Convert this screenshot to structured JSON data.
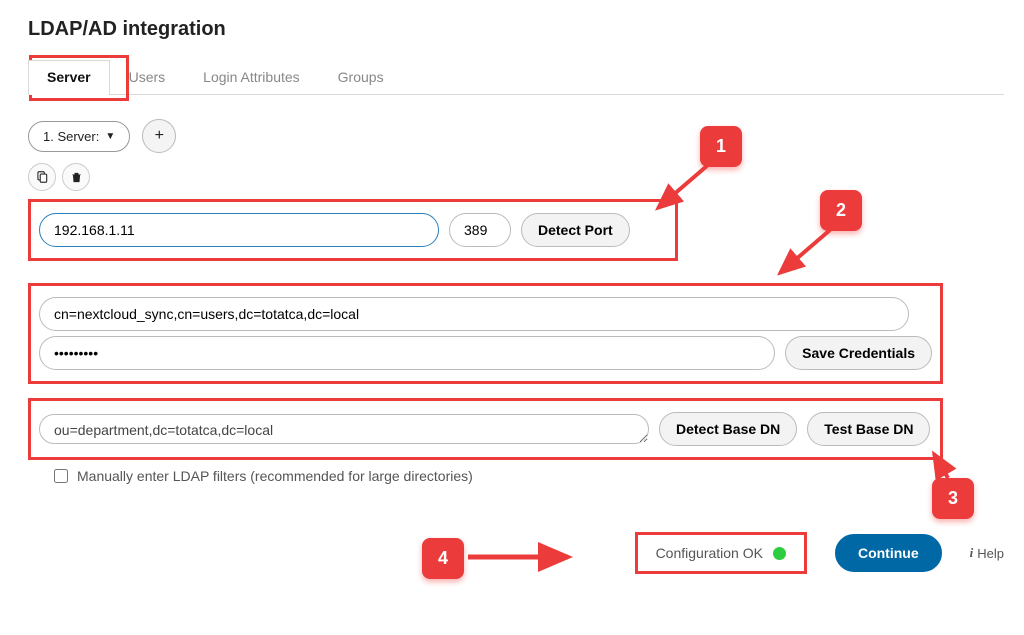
{
  "page_title": "LDAP/AD integration",
  "tabs": {
    "server": "Server",
    "users": "Users",
    "login_attributes": "Login Attributes",
    "groups": "Groups"
  },
  "server_select": {
    "label": "1. Server:"
  },
  "buttons": {
    "add": "+",
    "detect_port": "Detect Port",
    "save_credentials": "Save Credentials",
    "detect_base_dn": "Detect Base DN",
    "test_base_dn": "Test Base DN",
    "continue": "Continue"
  },
  "fields": {
    "host": "192.168.1.11",
    "port": "389",
    "bind_dn": "cn=nextcloud_sync,cn=users,dc=totatca,dc=local",
    "password": "•••••••••",
    "base_dn_prefix": "ou",
    "base_dn_rest": "=department,dc=totatca,dc=local"
  },
  "checkbox": {
    "manual_filters": "Manually enter LDAP filters (recommended for large directories)"
  },
  "status": {
    "text": "Configuration OK"
  },
  "help": {
    "label": "Help"
  },
  "callouts": {
    "c1": "1",
    "c2": "2",
    "c3": "3",
    "c4": "4"
  }
}
